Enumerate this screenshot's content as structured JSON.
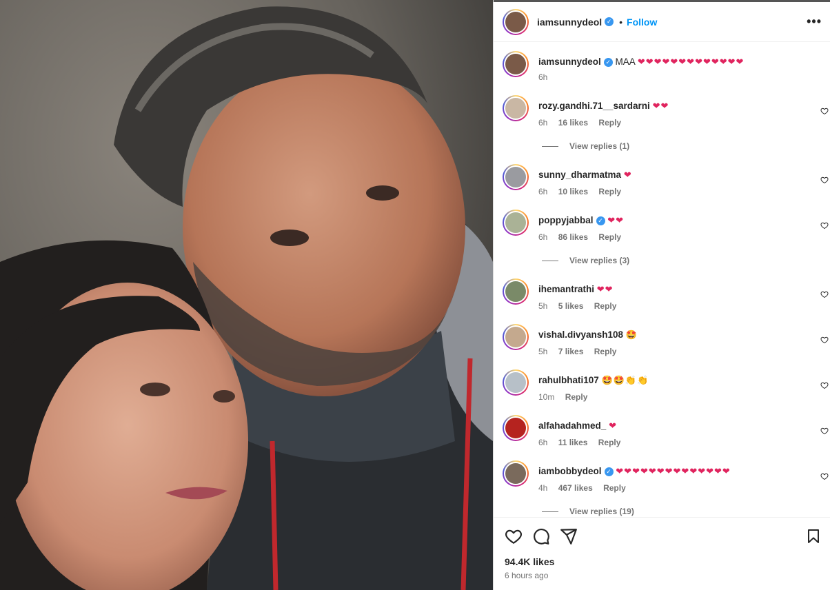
{
  "post": {
    "author": "iamsunnydeol",
    "follow_label": "Follow",
    "dot": "•",
    "more_label": "•••",
    "likes_label": "94.4K likes",
    "time_ago": "6 hours ago"
  },
  "colors": {
    "accent": "#0095f6",
    "heart": "#e0245e",
    "verified": "#3897f0",
    "meta": "#737373"
  },
  "caption": {
    "name": "iamsunnydeol",
    "text": "MAA",
    "emoji": "❤❤❤❤❤❤❤❤❤❤❤❤❤",
    "time": "6h"
  },
  "comments": [
    {
      "name": "rozy.gandhi.71__sardarni",
      "verified": false,
      "emoji": "❤❤",
      "time": "6h",
      "likes": "16 likes",
      "reply": "Reply",
      "avatar": "#c9b7a4"
    },
    {
      "name": "sunny_dharmatma",
      "verified": false,
      "emoji": "❤",
      "time": "6h",
      "likes": "10 likes",
      "reply": "Reply",
      "avatar": "#9a9ba0"
    },
    {
      "name": "poppyjabbal",
      "verified": true,
      "emoji": "❤❤",
      "time": "6h",
      "likes": "86 likes",
      "reply": "Reply",
      "avatar": "#aab296"
    },
    {
      "name": "ihemantrathi",
      "verified": false,
      "emoji": "❤❤",
      "time": "5h",
      "likes": "5 likes",
      "reply": "Reply",
      "avatar": "#7a8a68"
    },
    {
      "name": "vishal.divyansh108",
      "verified": false,
      "emoji": "🤩",
      "time": "5h",
      "likes": "7 likes",
      "reply": "Reply",
      "avatar": "#c4a98e"
    },
    {
      "name": "rahulbhati107",
      "verified": false,
      "emoji": "🤩🤩👏👏",
      "time": "10m",
      "likes": "",
      "reply": "Reply",
      "avatar": "#b7c0c8"
    },
    {
      "name": "alfahadahmed_",
      "verified": false,
      "emoji": "❤",
      "time": "6h",
      "likes": "11 likes",
      "reply": "Reply",
      "avatar": "#b5231f"
    },
    {
      "name": "iambobbydeol",
      "verified": true,
      "emoji": "❤❤❤❤❤❤❤❤❤❤❤❤❤❤",
      "time": "4h",
      "likes": "467 likes",
      "reply": "Reply",
      "avatar": "#7a6a5c"
    }
  ],
  "view_replies": [
    "View replies (1)",
    "View replies (3)",
    "View replies (19)"
  ],
  "icons": [
    "heart-icon",
    "comment-icon",
    "share-icon",
    "bookmark-icon"
  ]
}
